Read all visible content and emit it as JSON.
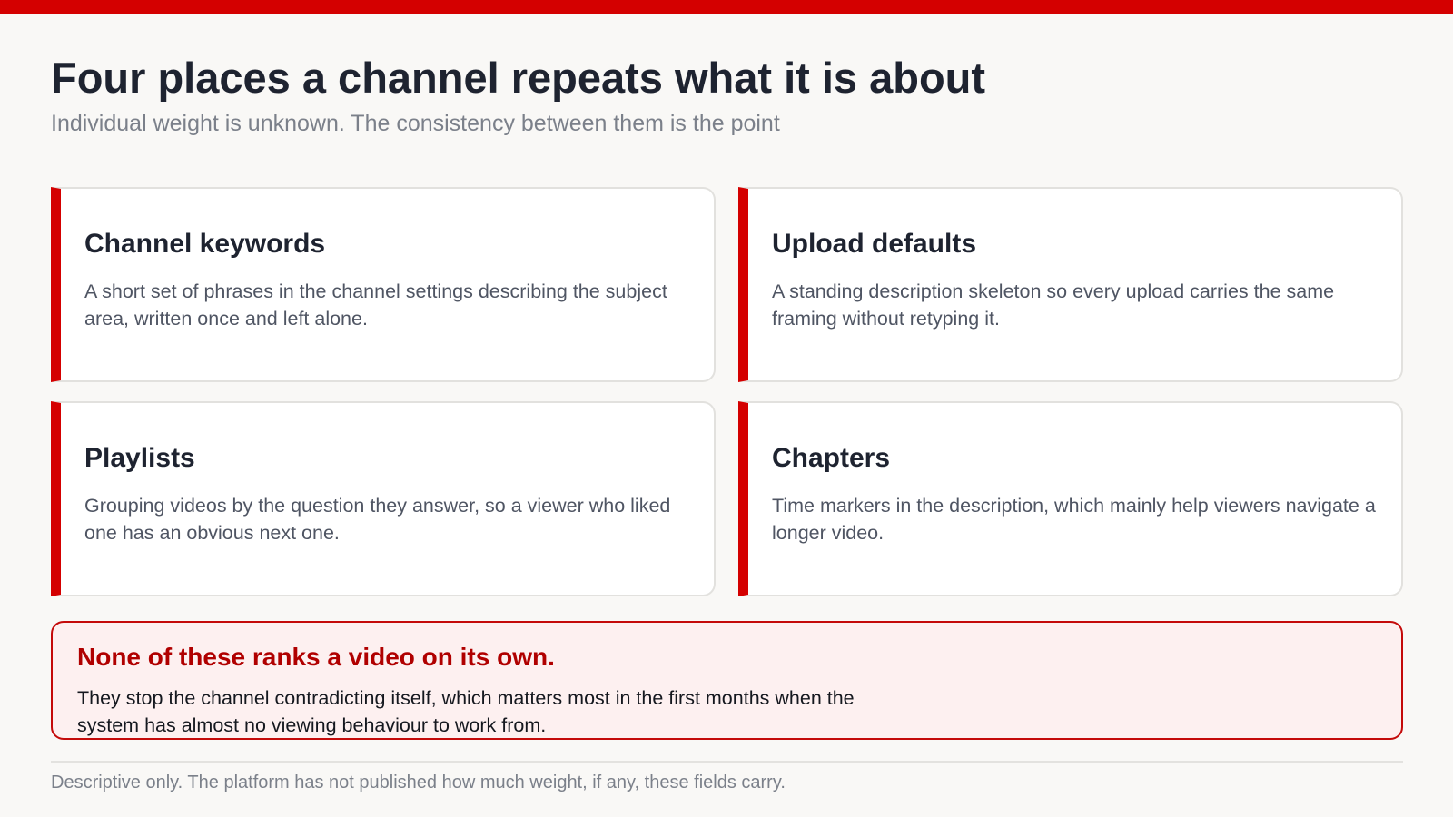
{
  "header": {
    "title": "Four places a channel repeats what it is about",
    "subtitle": "Individual weight is unknown. The consistency between them is the point"
  },
  "cards": [
    {
      "heading": "Channel keywords",
      "body": "A short set of phrases in the channel settings describing the subject area, written once and left alone."
    },
    {
      "heading": "Upload defaults",
      "body": "A standing description skeleton so every upload carries the same framing without retyping it."
    },
    {
      "heading": "Playlists",
      "body": "Grouping videos by the question they answer, so a viewer who liked one has an obvious next one."
    },
    {
      "heading": "Chapters",
      "body": "Time markers in the description, which mainly help viewers navigate a longer video."
    }
  ],
  "callout": {
    "heading": "None of these ranks a video on its own.",
    "body": "They stop the channel contradicting itself, which matters most in the first months when the system has almost no viewing behaviour to work from."
  },
  "footer": {
    "note": "Descriptive only. The platform has not published how much weight, if any, these fields carry."
  },
  "colors": {
    "accent": "#d40000",
    "callout_background": "#fdf0f0",
    "callout_heading": "#b00000",
    "page_background": "#f9f8f6"
  }
}
